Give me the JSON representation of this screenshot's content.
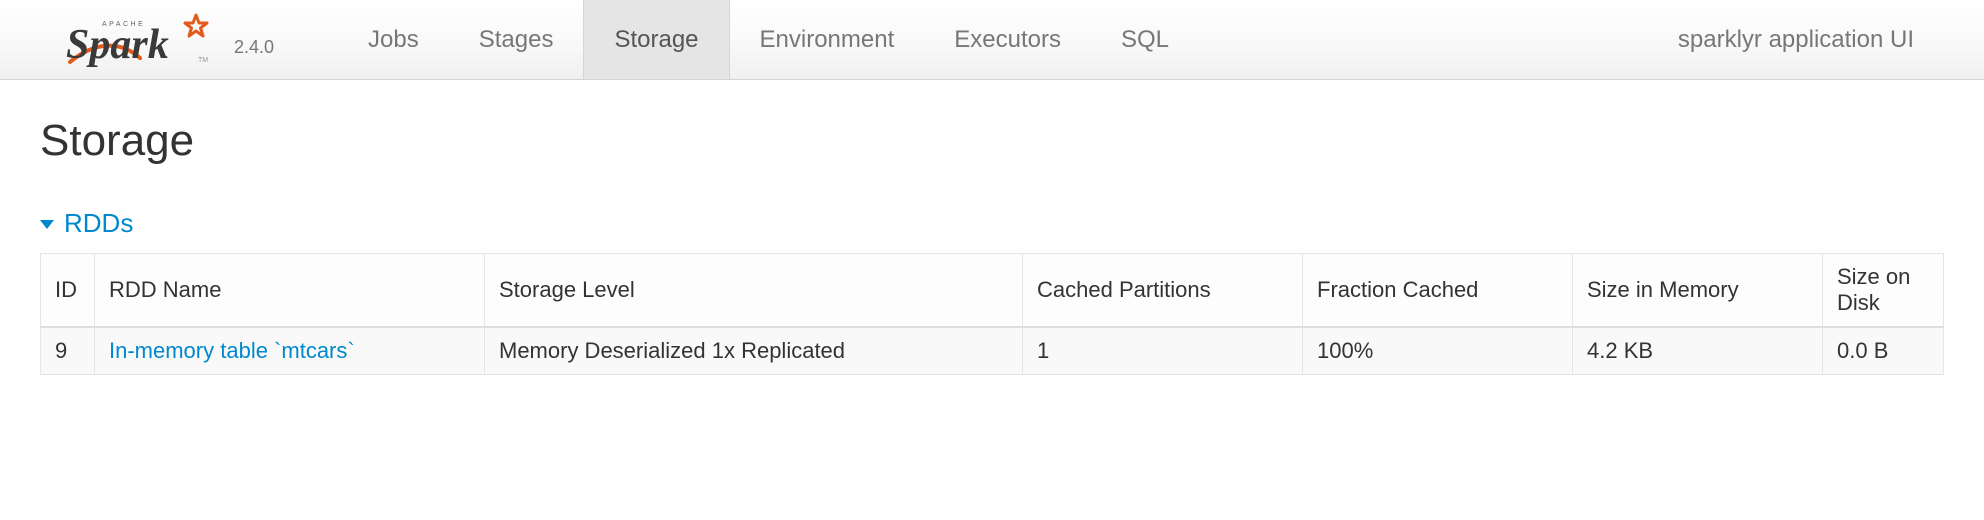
{
  "brand": {
    "small_text": "APACHE",
    "wordmark_main": "Spark",
    "version": "2.4.0"
  },
  "nav": {
    "tabs": [
      {
        "label": "Jobs",
        "active": false
      },
      {
        "label": "Stages",
        "active": false
      },
      {
        "label": "Storage",
        "active": true
      },
      {
        "label": "Environment",
        "active": false
      },
      {
        "label": "Executors",
        "active": false
      },
      {
        "label": "SQL",
        "active": false
      }
    ],
    "app_name": "sparklyr application UI"
  },
  "page": {
    "title": "Storage",
    "section_label": "RDDs"
  },
  "table": {
    "headers": [
      "ID",
      "RDD Name",
      "Storage Level",
      "Cached Partitions",
      "Fraction Cached",
      "Size in Memory",
      "Size on Disk"
    ],
    "rows": [
      {
        "id": "9",
        "name": "In-memory table `mtcars`",
        "level": "Memory Deserialized 1x Replicated",
        "partitions": "1",
        "fraction": "100%",
        "mem": "4.2 KB",
        "disk": "0.0 B"
      }
    ]
  }
}
